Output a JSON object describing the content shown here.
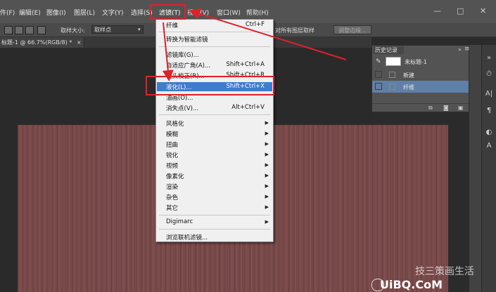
{
  "menubar": {
    "items": [
      "件(F)",
      "编辑(E)",
      "图像(I)",
      "图层(L)",
      "文字(Y)",
      "选择(S)",
      "滤镜(T)",
      "视图(V)",
      "窗口(W)",
      "帮助(H)"
    ],
    "controls": [
      "—",
      "□",
      "✕"
    ]
  },
  "options_bar": {
    "sample_size_label": "取样大小:",
    "sample_size_value": "取样点",
    "sample_all_layers_label": "对所有图层取样",
    "refine_edge_button": "调整边缘..."
  },
  "document": {
    "tab_label": "标题-1 @ 66.7%(RGB/8) *",
    "tab_close": "×"
  },
  "filter_menu": {
    "items": [
      {
        "label": "纤维",
        "shortcut": "Ctrl+F"
      },
      {
        "label": "转换为智能滤镜",
        "shortcut": ""
      },
      {
        "label": "滤镜库(G)...",
        "shortcut": ""
      },
      {
        "label": "自适应广角(A)...",
        "shortcut": "Shift+Ctrl+A"
      },
      {
        "label": "镜头校正(R)...",
        "shortcut": "Shift+Ctrl+R"
      },
      {
        "label": "液化(L)...",
        "shortcut": "Shift+Ctrl+X",
        "highlighted": true
      },
      {
        "label": "油画(O)...",
        "shortcut": ""
      },
      {
        "label": "消失点(V)...",
        "shortcut": "Alt+Ctrl+V"
      },
      {
        "label": "风格化",
        "submenu": true
      },
      {
        "label": "模糊",
        "submenu": true
      },
      {
        "label": "扭曲",
        "submenu": true
      },
      {
        "label": "锐化",
        "submenu": true
      },
      {
        "label": "视频",
        "submenu": true
      },
      {
        "label": "像素化",
        "submenu": true
      },
      {
        "label": "渲染",
        "submenu": true
      },
      {
        "label": "杂色",
        "submenu": true
      },
      {
        "label": "其它",
        "submenu": true
      },
      {
        "label": "Digimarc",
        "submenu": true
      },
      {
        "label": "浏览联机滤镜...",
        "shortcut": ""
      }
    ]
  },
  "history_panel": {
    "title": "历史记录",
    "snapshot_label": "未标题-1",
    "states": [
      "新建",
      "纤维"
    ]
  },
  "watermark": "UiBQ.CoM",
  "watermark_faint": "技三策画生活",
  "colors": {
    "highlight": "#3d7dcc",
    "annotation_red": "#e0202a",
    "canvas": "#7a4a4a"
  }
}
